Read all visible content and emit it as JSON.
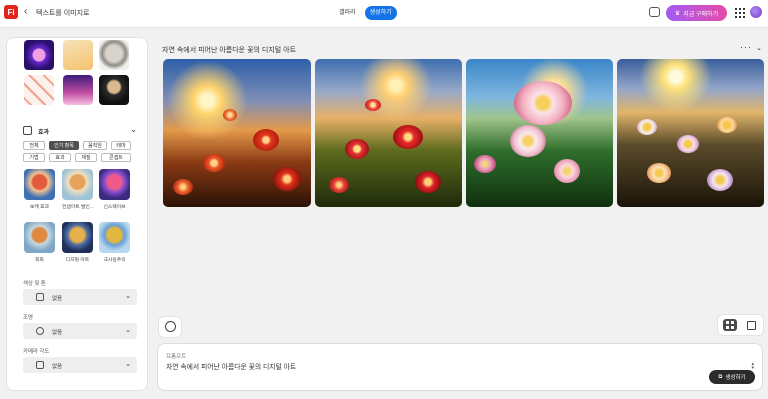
{
  "header": {
    "logo_text": "Fi",
    "back_glyph": "‹",
    "title": "텍스트를 이미지로",
    "tabs": [
      {
        "label": "갤러리",
        "active": false
      },
      {
        "label": "생성하기",
        "active": true
      }
    ],
    "buy_label": "지금 구매하기",
    "buy_icon": "crown-icon"
  },
  "left_panel": {
    "effects": {
      "title": "효과",
      "filters": [
        "전체",
        "인기 항목",
        "움직임",
        "테마",
        "기법",
        "효과",
        "재질",
        "콘셉트"
      ],
      "selected_filter": "인기 항목",
      "styles": [
        {
          "label": "보케 효과"
        },
        {
          "label": "컨셉아트 발인..."
        },
        {
          "label": "신스웨이브"
        },
        {
          "label": "회화"
        },
        {
          "label": "디지털 아트"
        },
        {
          "label": "극사실주의"
        }
      ]
    },
    "color_tone": {
      "label": "색상 및 톤",
      "value": "없음"
    },
    "lighting": {
      "label": "조명",
      "value": "없음"
    },
    "camera_angle": {
      "label": "카메라 각도",
      "value": "없음"
    }
  },
  "main": {
    "prompt_title": "자연 속에서 피어난 아름다운 꽃의 디지털 아트",
    "more_label": "···",
    "prompt_box": {
      "label": "프롬프트",
      "text": "자연 속에서 피어난 아름다운 꽃의 디지털 아트"
    },
    "generate_label": "생성하기"
  },
  "colors": {
    "accent": "#1473e6",
    "buy_gradient_start": "#a25cf3",
    "buy_gradient_end": "#e64aa6"
  }
}
